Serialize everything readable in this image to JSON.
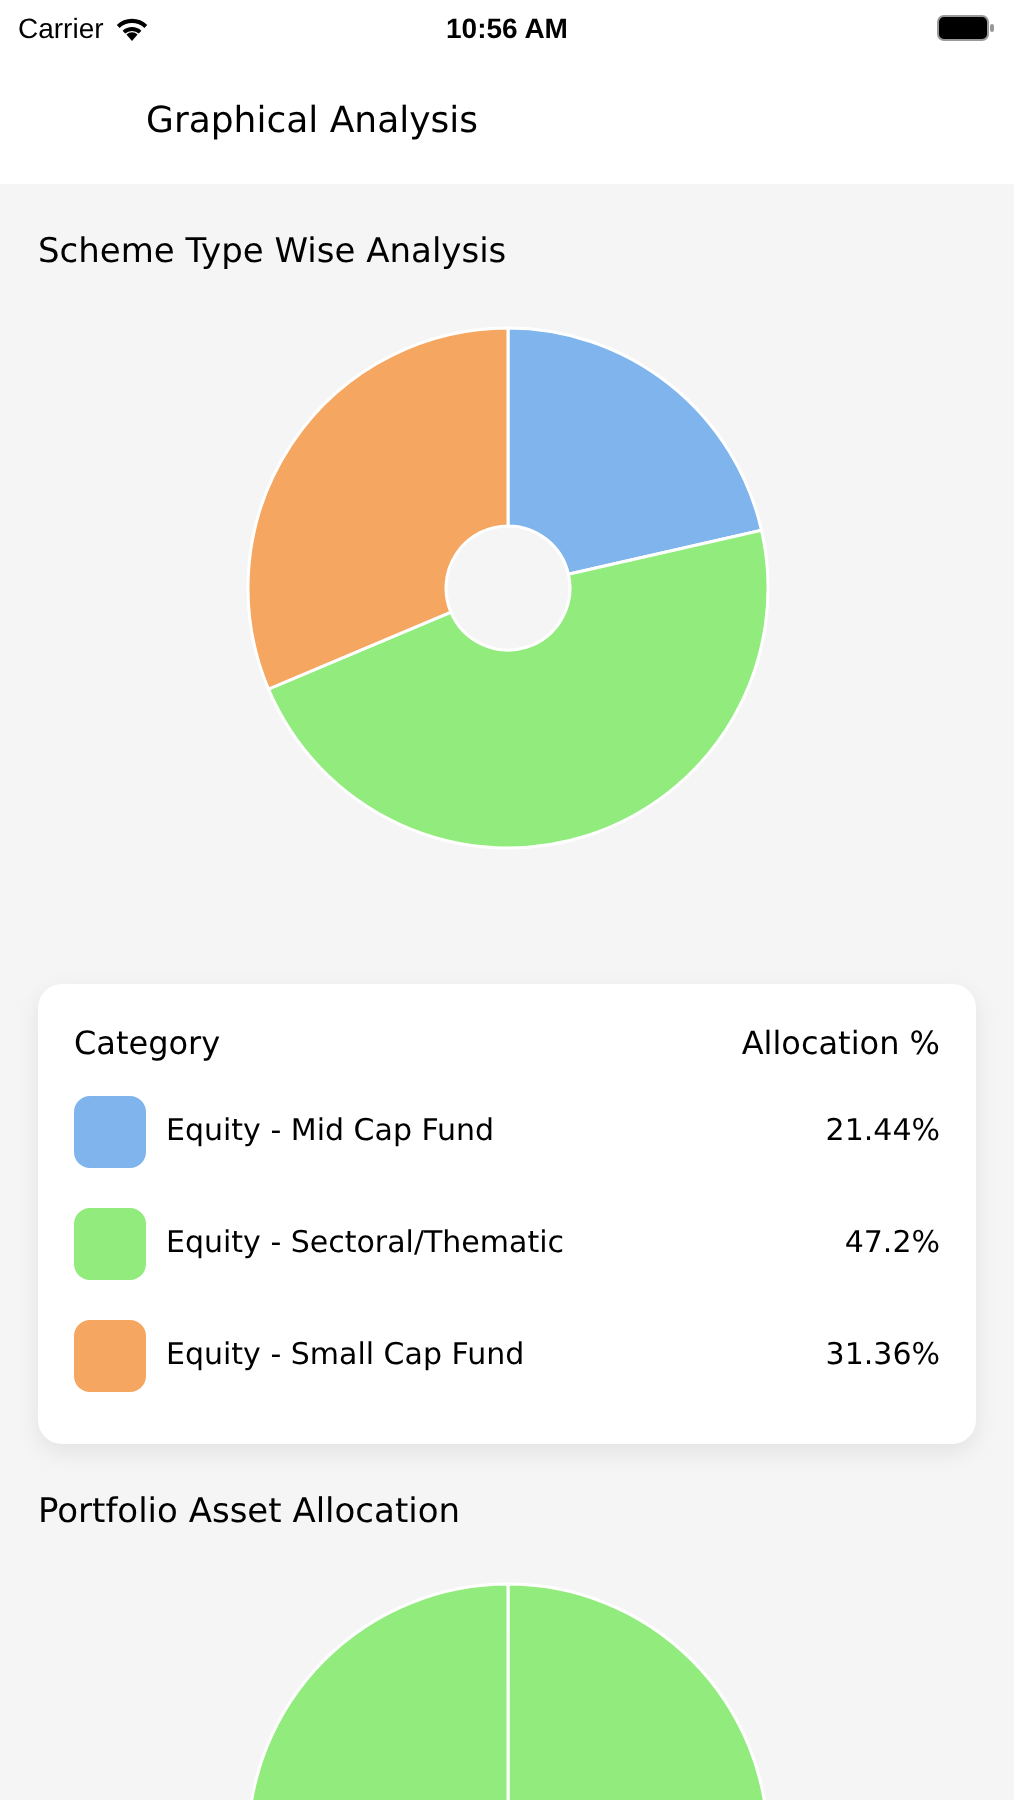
{
  "status_bar": {
    "carrier": "Carrier",
    "time": "10:56 AM"
  },
  "header": {
    "title": "Graphical Analysis"
  },
  "scheme_section": {
    "title": "Scheme Type Wise Analysis"
  },
  "legend": {
    "columns": [
      "Category",
      "Allocation %"
    ],
    "rows": [
      {
        "label": "Equity - Mid Cap Fund",
        "value": "21.44%",
        "color": "#7fb5ec"
      },
      {
        "label": "Equity - Sectoral/Thematic",
        "value": "47.2%",
        "color": "#92eb7d"
      },
      {
        "label": "Equity - Small Cap Fund",
        "value": "31.36%",
        "color": "#f5a660"
      }
    ]
  },
  "asset_section": {
    "title": "Portfolio Asset Allocation"
  }
}
